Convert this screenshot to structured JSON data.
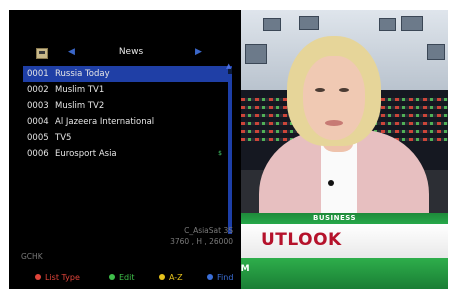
{
  "menu": {
    "group_name": "News",
    "channels": [
      {
        "number": "0001",
        "name": "Russia Today",
        "selected": true,
        "tag": ""
      },
      {
        "number": "0002",
        "name": "Muslim TV1",
        "selected": false,
        "tag": ""
      },
      {
        "number": "0003",
        "name": "Muslim TV2",
        "selected": false,
        "tag": ""
      },
      {
        "number": "0004",
        "name": "Al Jazeera International",
        "selected": false,
        "tag": ""
      },
      {
        "number": "0005",
        "name": "TV5",
        "selected": false,
        "tag": ""
      },
      {
        "number": "0006",
        "name": "Eurosport Asia",
        "selected": false,
        "tag": "$"
      }
    ],
    "satellite": {
      "name": "C_AsiaSat 3S",
      "transponder": "3760 , H , 26000"
    },
    "status_code": "GCHK",
    "legend": [
      {
        "label": "List Type",
        "color": "#e0443a",
        "text_color": "#e0443a"
      },
      {
        "label": "Edit",
        "color": "#3fbf4a",
        "text_color": "#3fbf4a"
      },
      {
        "label": "A-Z",
        "color": "#e6c21c",
        "text_color": "#e6c21c"
      },
      {
        "label": "Find",
        "color": "#3b6fd8",
        "text_color": "#3b6fd8"
      }
    ]
  },
  "video": {
    "lower_third_top": "BUSINESS",
    "lower_third_main": "UTLOOK",
    "lower_third_bottom": "OM"
  }
}
